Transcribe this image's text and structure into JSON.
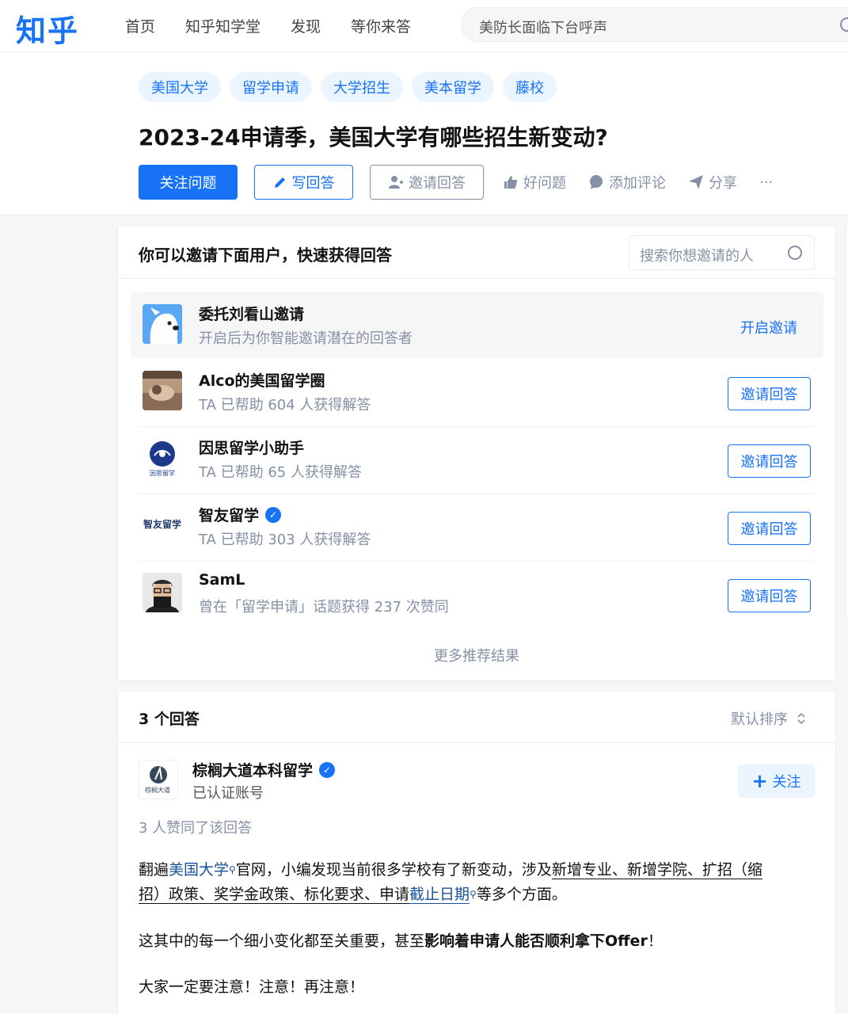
{
  "nav": {
    "logo": "知乎",
    "links": [
      "首页",
      "知乎知学堂",
      "发现",
      "等你来答"
    ],
    "search_placeholder": "美防长面临下台呼声"
  },
  "question": {
    "tags": [
      "美国大学",
      "留学申请",
      "大学招生",
      "美本留学",
      "藤校"
    ],
    "title": "2023-24申请季，美国大学有哪些招生新变动?",
    "follow_label": "关注问题",
    "write_label": "写回答",
    "invite_label": "邀请回答",
    "good_label": "好问题",
    "comment_label": "添加评论",
    "share_label": "分享",
    "more_label": "···"
  },
  "invite": {
    "title": "你可以邀请下面用户，快速获得回答",
    "search_placeholder": "搜索你想邀请的人",
    "delegate": {
      "name": "委托刘看山邀请",
      "desc": "开启后为你智能邀请潜在的回答者",
      "action": "开启邀请"
    },
    "users": [
      {
        "name": "Alco的美国留学圈",
        "desc": "TA 已帮助 604 人获得解答",
        "action": "邀请回答",
        "verified": false
      },
      {
        "name": "因思留学小助手",
        "desc": "TA 已帮助 65 人获得解答",
        "action": "邀请回答",
        "verified": false
      },
      {
        "name": "智友留学",
        "desc": "TA 已帮助 303 人获得解答",
        "action": "邀请回答",
        "verified": true
      },
      {
        "name": "SamL",
        "desc": "曾在「留学申请」话题获得 237 次赞同",
        "action": "邀请回答",
        "verified": false
      }
    ],
    "avatar_text": {
      "insight": "因思留学",
      "zhiyou": "智友留学"
    },
    "more": "更多推荐结果"
  },
  "answers": {
    "count": "3 个回答",
    "sort": "默认排序",
    "author": {
      "name": "棕榈大道本科留学",
      "desc": "已认证账号",
      "follow": "关注",
      "avatar_text": "棕榈大道"
    },
    "votes": "3 人赞同了该回答",
    "p1": {
      "a": "翻遍",
      "link1": "美国大学",
      "b": "官网，小编发现当前很多学校有了新变动，涉及",
      "u1": "新增专业、新增学院、扩招（缩",
      "u2": "招）政策、奖学金政策、标化要求、申请",
      "link2": "截止日期",
      "c": "等多个方面。"
    },
    "p2": {
      "a": "这其中的每一个细小变化都至关重要，甚至",
      "b": "影响着申请人能否顺利拿下Offer",
      "c": "！"
    },
    "p3": "大家一定要注意！注意！再注意！"
  }
}
